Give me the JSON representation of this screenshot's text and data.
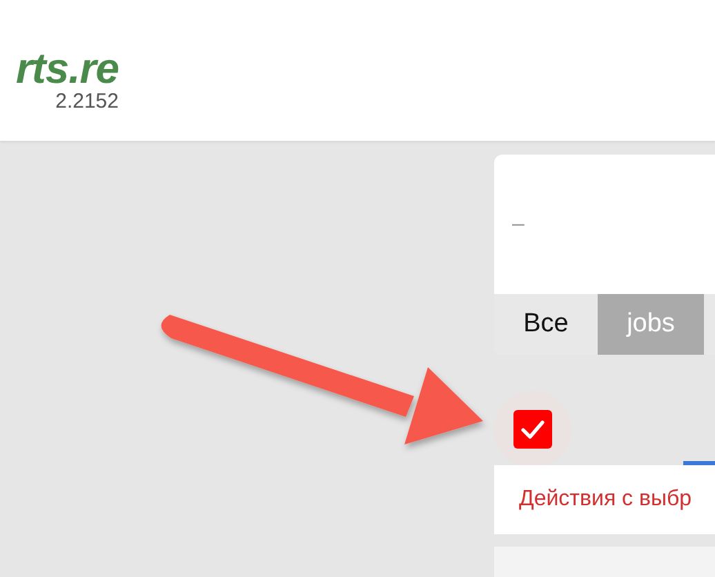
{
  "header": {
    "logo_text": "rts.re",
    "version": "2.2152"
  },
  "filter_card": {
    "value": "–",
    "tabs": [
      {
        "label": "Все",
        "selected": false
      },
      {
        "label": "jobs",
        "selected": true
      }
    ]
  },
  "select_all": {
    "checked": true
  },
  "actions_bar": {
    "label": "Действия с выбр"
  }
}
